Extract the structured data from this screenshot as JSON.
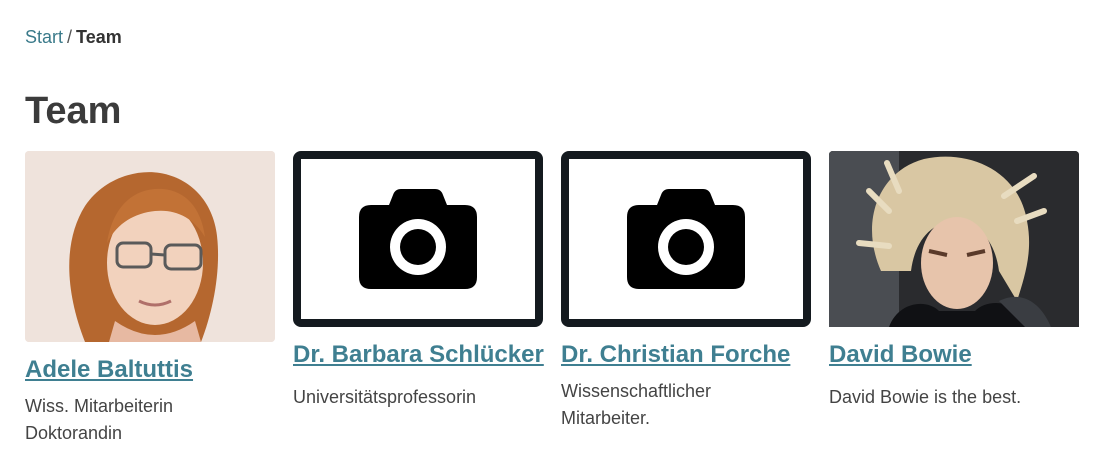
{
  "breadcrumb": {
    "home": "Start",
    "separator": "/",
    "current": "Team"
  },
  "page": {
    "title": "Team"
  },
  "colors": {
    "link": "#3f7f91",
    "placeholder_frame": "#141a1f"
  },
  "members": [
    {
      "name": "Adele Baltuttis",
      "description_lines": [
        "Wiss. Mitarbeiterin",
        "Doktorandin"
      ],
      "photo": "portrait-photo"
    },
    {
      "name": "Dr. Barbara Schlücker",
      "description_lines": [
        "Universitätsprofessorin"
      ],
      "photo": "camera-placeholder-icon"
    },
    {
      "name": "Dr. Christian Forche",
      "description_lines": [
        "Wissenschaftlicher",
        "Mitarbeiter."
      ],
      "photo": "camera-placeholder-icon"
    },
    {
      "name": "David Bowie",
      "description_lines": [
        "David Bowie is the best."
      ],
      "photo": "portrait-photo"
    }
  ]
}
